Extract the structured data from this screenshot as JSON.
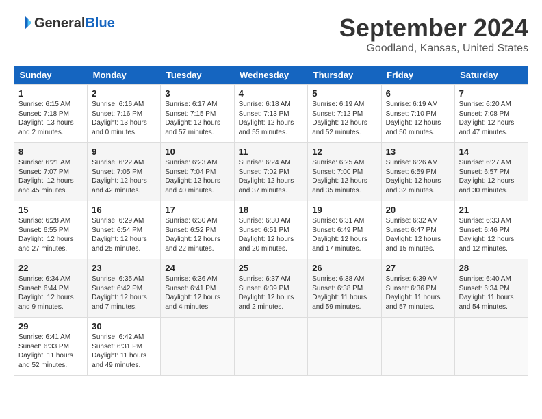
{
  "header": {
    "logo": {
      "general": "General",
      "blue": "Blue"
    },
    "month": "September 2024",
    "location": "Goodland, Kansas, United States"
  },
  "calendar": {
    "weekdays": [
      "Sunday",
      "Monday",
      "Tuesday",
      "Wednesday",
      "Thursday",
      "Friday",
      "Saturday"
    ],
    "weeks": [
      [
        {
          "day": "1",
          "sunrise": "6:15 AM",
          "sunset": "7:18 PM",
          "daylight": "13 hours and 2 minutes."
        },
        {
          "day": "2",
          "sunrise": "6:16 AM",
          "sunset": "7:16 PM",
          "daylight": "13 hours and 0 minutes."
        },
        {
          "day": "3",
          "sunrise": "6:17 AM",
          "sunset": "7:15 PM",
          "daylight": "12 hours and 57 minutes."
        },
        {
          "day": "4",
          "sunrise": "6:18 AM",
          "sunset": "7:13 PM",
          "daylight": "12 hours and 55 minutes."
        },
        {
          "day": "5",
          "sunrise": "6:19 AM",
          "sunset": "7:12 PM",
          "daylight": "12 hours and 52 minutes."
        },
        {
          "day": "6",
          "sunrise": "6:19 AM",
          "sunset": "7:10 PM",
          "daylight": "12 hours and 50 minutes."
        },
        {
          "day": "7",
          "sunrise": "6:20 AM",
          "sunset": "7:08 PM",
          "daylight": "12 hours and 47 minutes."
        }
      ],
      [
        {
          "day": "8",
          "sunrise": "6:21 AM",
          "sunset": "7:07 PM",
          "daylight": "12 hours and 45 minutes."
        },
        {
          "day": "9",
          "sunrise": "6:22 AM",
          "sunset": "7:05 PM",
          "daylight": "12 hours and 42 minutes."
        },
        {
          "day": "10",
          "sunrise": "6:23 AM",
          "sunset": "7:04 PM",
          "daylight": "12 hours and 40 minutes."
        },
        {
          "day": "11",
          "sunrise": "6:24 AM",
          "sunset": "7:02 PM",
          "daylight": "12 hours and 37 minutes."
        },
        {
          "day": "12",
          "sunrise": "6:25 AM",
          "sunset": "7:00 PM",
          "daylight": "12 hours and 35 minutes."
        },
        {
          "day": "13",
          "sunrise": "6:26 AM",
          "sunset": "6:59 PM",
          "daylight": "12 hours and 32 minutes."
        },
        {
          "day": "14",
          "sunrise": "6:27 AM",
          "sunset": "6:57 PM",
          "daylight": "12 hours and 30 minutes."
        }
      ],
      [
        {
          "day": "15",
          "sunrise": "6:28 AM",
          "sunset": "6:55 PM",
          "daylight": "12 hours and 27 minutes."
        },
        {
          "day": "16",
          "sunrise": "6:29 AM",
          "sunset": "6:54 PM",
          "daylight": "12 hours and 25 minutes."
        },
        {
          "day": "17",
          "sunrise": "6:30 AM",
          "sunset": "6:52 PM",
          "daylight": "12 hours and 22 minutes."
        },
        {
          "day": "18",
          "sunrise": "6:30 AM",
          "sunset": "6:51 PM",
          "daylight": "12 hours and 20 minutes."
        },
        {
          "day": "19",
          "sunrise": "6:31 AM",
          "sunset": "6:49 PM",
          "daylight": "12 hours and 17 minutes."
        },
        {
          "day": "20",
          "sunrise": "6:32 AM",
          "sunset": "6:47 PM",
          "daylight": "12 hours and 15 minutes."
        },
        {
          "day": "21",
          "sunrise": "6:33 AM",
          "sunset": "6:46 PM",
          "daylight": "12 hours and 12 minutes."
        }
      ],
      [
        {
          "day": "22",
          "sunrise": "6:34 AM",
          "sunset": "6:44 PM",
          "daylight": "12 hours and 9 minutes."
        },
        {
          "day": "23",
          "sunrise": "6:35 AM",
          "sunset": "6:42 PM",
          "daylight": "12 hours and 7 minutes."
        },
        {
          "day": "24",
          "sunrise": "6:36 AM",
          "sunset": "6:41 PM",
          "daylight": "12 hours and 4 minutes."
        },
        {
          "day": "25",
          "sunrise": "6:37 AM",
          "sunset": "6:39 PM",
          "daylight": "12 hours and 2 minutes."
        },
        {
          "day": "26",
          "sunrise": "6:38 AM",
          "sunset": "6:38 PM",
          "daylight": "11 hours and 59 minutes."
        },
        {
          "day": "27",
          "sunrise": "6:39 AM",
          "sunset": "6:36 PM",
          "daylight": "11 hours and 57 minutes."
        },
        {
          "day": "28",
          "sunrise": "6:40 AM",
          "sunset": "6:34 PM",
          "daylight": "11 hours and 54 minutes."
        }
      ],
      [
        {
          "day": "29",
          "sunrise": "6:41 AM",
          "sunset": "6:33 PM",
          "daylight": "11 hours and 52 minutes."
        },
        {
          "day": "30",
          "sunrise": "6:42 AM",
          "sunset": "6:31 PM",
          "daylight": "11 hours and 49 minutes."
        },
        null,
        null,
        null,
        null,
        null
      ]
    ]
  }
}
